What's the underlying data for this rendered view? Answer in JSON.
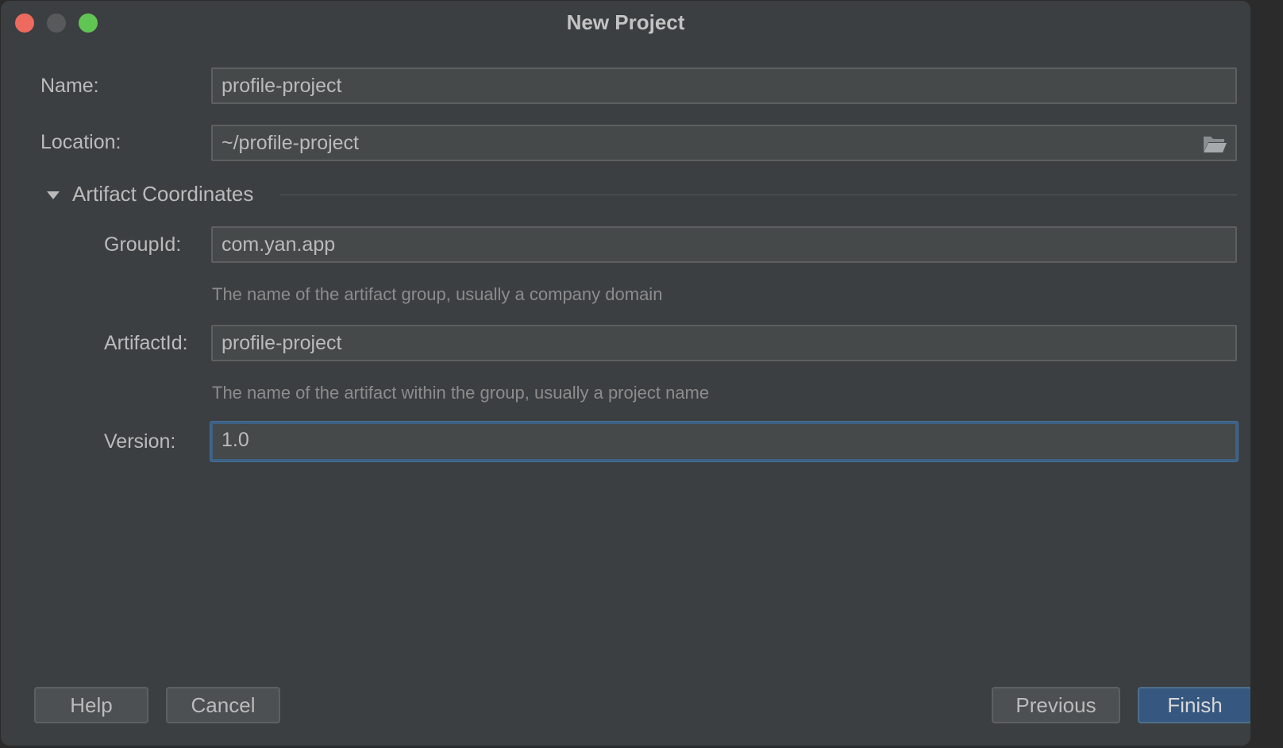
{
  "window": {
    "title": "New Project"
  },
  "form": {
    "name": {
      "label": "Name:",
      "value": "profile-project"
    },
    "location": {
      "label": "Location:",
      "value": "~/profile-project",
      "browse_icon": "folder-icon"
    },
    "artifact_section": {
      "title": "Artifact Coordinates",
      "expanded": true,
      "group_id": {
        "label": "GroupId:",
        "value": "com.yan.app",
        "hint": "The name of the artifact group, usually a company domain"
      },
      "artifact_id": {
        "label": "ArtifactId:",
        "value": "profile-project",
        "hint": "The name of the artifact within the group, usually a project name"
      },
      "version": {
        "label": "Version:",
        "value": "1.0",
        "focused": true
      }
    }
  },
  "buttons": {
    "help": "Help",
    "cancel": "Cancel",
    "previous": "Previous",
    "finish": "Finish"
  },
  "colors": {
    "window_bg": "#3c3f41",
    "field_bg": "#45494a",
    "focus_border": "#3d6185",
    "primary_button": "#365880",
    "close": "#ec6a5e",
    "minimize": "#57595b",
    "maximize": "#61c554"
  }
}
